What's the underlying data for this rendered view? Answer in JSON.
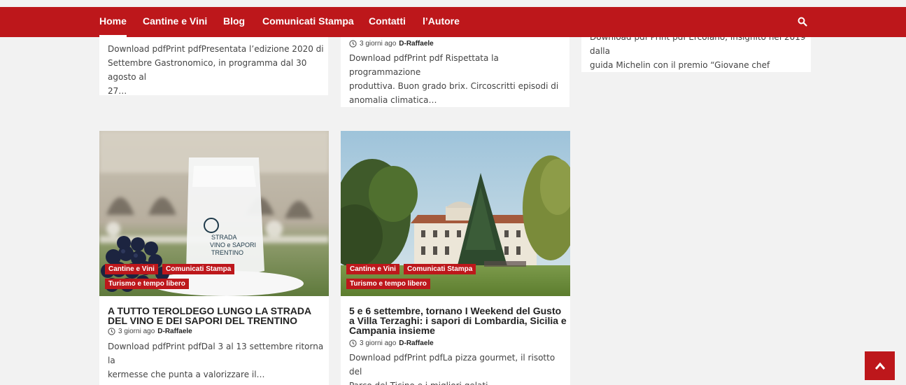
{
  "nav": {
    "items": [
      "Home",
      "Cantine e Vini",
      "Blog",
      "Comunicati Stampa",
      "Contatti",
      "l’Autore"
    ]
  },
  "top_cards": [
    {
      "excerpt_lines": [
        "Download pdfPrint pdfPresentata l’edizione 2020 di",
        "Settembre Gastronomico, in programma dal 30 agosto al",
        "27…"
      ]
    },
    {
      "date": "3 giorni ago",
      "author": "D-Raffaele",
      "excerpt_lines": [
        "Download pdfPrint pdf Rispettata la programmazione",
        "produttiva. Buon grado brix. Circoscritti episodi di",
        "anomalia climatica…"
      ]
    },
    {
      "excerpt_lines": [
        "Download pdf Print pdf Ercolano, insignito nel 2019 dalla",
        "guida Michelin con il premio “Giovane chef dell’anno”,…"
      ]
    }
  ],
  "posts": [
    {
      "categories": [
        "Cantine e Vini",
        "Comunicati Stampa",
        "Turismo e tempo libero"
      ],
      "title_lines": [
        "A TUTTO TEROLDEGO LUNGO LA STRADA",
        "DEL VINO E DEI SAPORI DEL TRENTINO"
      ],
      "date": "3 giorni ago",
      "author": "D-Raffaele",
      "excerpt_lines": [
        "Download pdfPrint pdfDal 3 al 13 settembre ritorna la",
        "kermesse che punta a valorizzare il…"
      ],
      "cup_text": [
        "STRADA",
        "VINO e SAPORI",
        "TRENTINO"
      ]
    },
    {
      "categories": [
        "Cantine e Vini",
        "Comunicati Stampa",
        "Turismo e tempo libero"
      ],
      "title_lines": [
        "5 e 6 settembre, tornano I Weekend del Gusto",
        "a Villa Terzaghi: i sapori di Lombardia, Sicilia e",
        "Campania insieme"
      ],
      "date": "3 giorni ago",
      "author": "D-Raffaele",
      "excerpt_lines": [
        "Download pdfPrint pdfLa pizza gourmet, il risotto del",
        "Parco del Ticino e i migliori gelati…"
      ]
    }
  ],
  "colors": {
    "brand": "#bd171b",
    "background": "#f2f2f2",
    "card": "#ffffff"
  },
  "icons": {
    "search": "search-icon",
    "clock": "clock-icon",
    "scroll_top": "chevron-up-icon"
  }
}
